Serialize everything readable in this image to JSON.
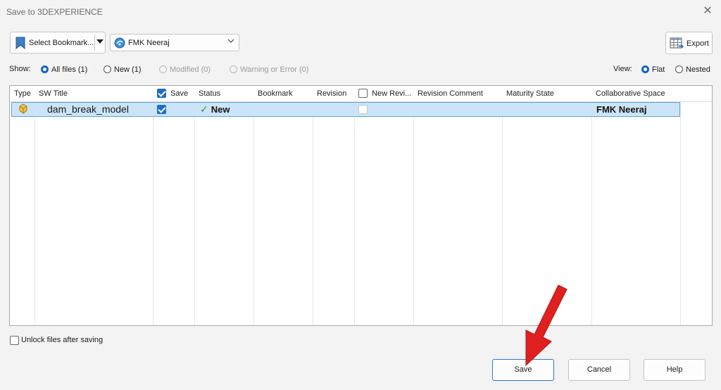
{
  "window": {
    "title": "Save to 3DEXPERIENCE",
    "close_label": "✕"
  },
  "toolbar": {
    "bookmark_label": "Select Bookmark...",
    "space_label": "FMK Neeraj",
    "export_label": "Export"
  },
  "show": {
    "label": "Show:",
    "options": [
      {
        "label": "All files (1)",
        "selected": true,
        "enabled": true
      },
      {
        "label": "New (1)",
        "selected": false,
        "enabled": true
      },
      {
        "label": "Modified (0)",
        "selected": false,
        "enabled": false
      },
      {
        "label": "Warning or Error (0)",
        "selected": false,
        "enabled": false
      }
    ]
  },
  "view": {
    "label": "View:",
    "options": [
      {
        "label": "Flat",
        "selected": true
      },
      {
        "label": "Nested",
        "selected": false
      }
    ]
  },
  "grid": {
    "columns": [
      "Type",
      "SW Title",
      "Save",
      "Status",
      "Bookmark",
      "Revision",
      "New Revi...",
      "Revision Comment",
      "Maturity State",
      "Collaborative Space"
    ],
    "save_header_checked": true,
    "new_revision_header_checked": false,
    "rows": [
      {
        "type_icon": "part-icon",
        "title": "dam_break_model",
        "save": true,
        "status": "New",
        "bookmark": "",
        "revision": "",
        "new_revision": false,
        "revision_comment": "",
        "maturity_state": "",
        "collaborative_space": "FMK Neeraj"
      }
    ]
  },
  "footer": {
    "unlock_label": "Unlock files after saving",
    "unlock_checked": false,
    "save_label": "Save",
    "cancel_label": "Cancel",
    "help_label": "Help"
  },
  "colors": {
    "accent": "#1f6fc6",
    "row_highlight": "#cce4f7",
    "annotation_arrow": "#e02020"
  }
}
